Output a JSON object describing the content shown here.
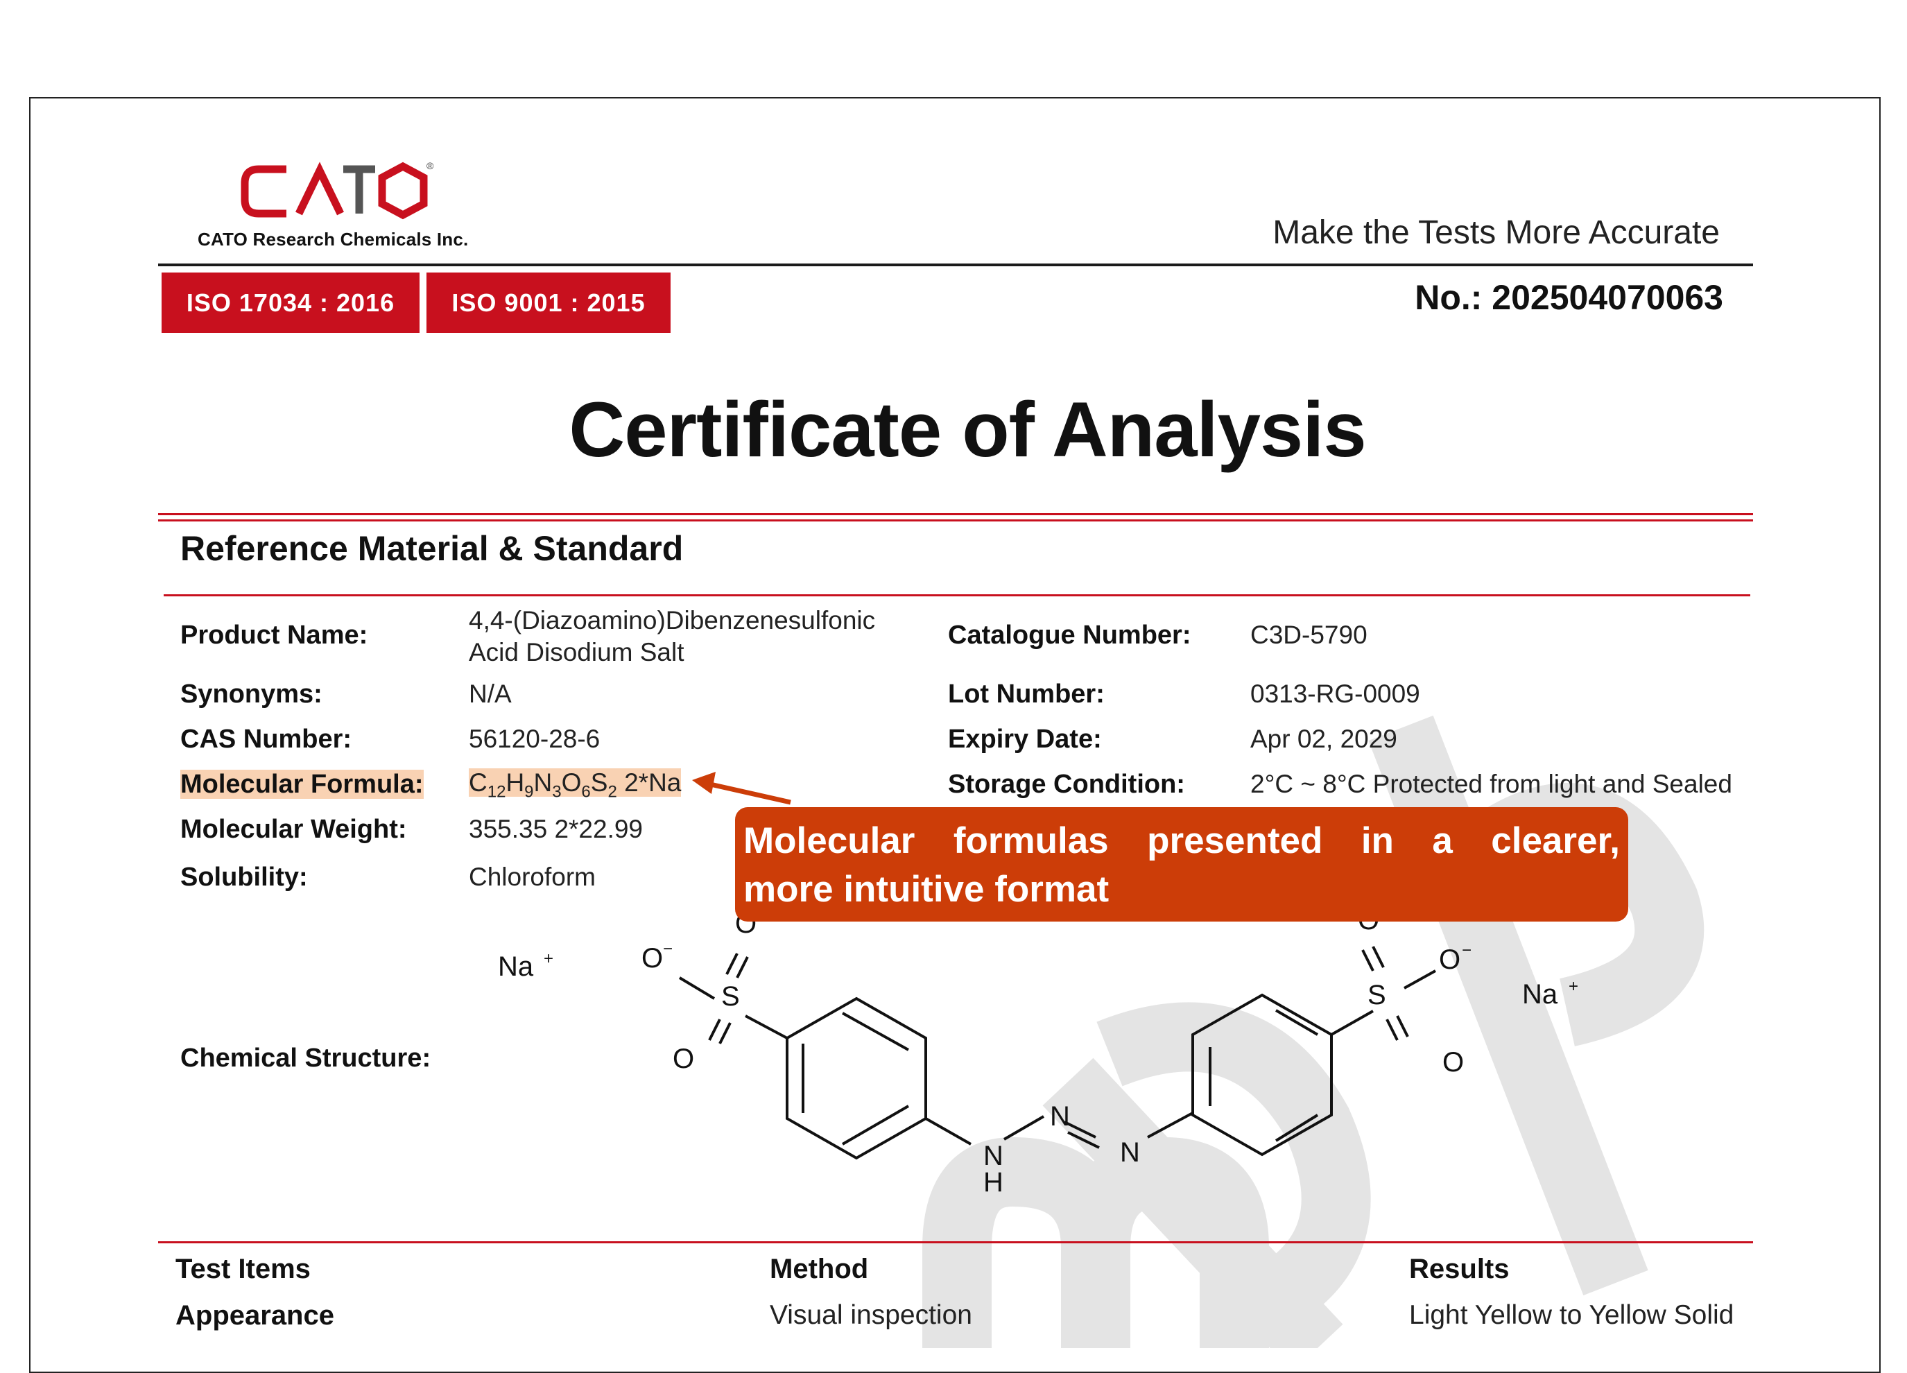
{
  "header": {
    "logo_text": "CATO",
    "company": "CATO Research Chemicals Inc.",
    "slogan": "Make the Tests More Accurate",
    "iso": [
      "ISO 17034 : 2016",
      "ISO 9001 : 2015"
    ],
    "doc_no": "No.: 202504070063"
  },
  "title": "Certificate of Analysis",
  "section_title": "Reference Material & Standard",
  "fields": {
    "product_name_label": "Product Name:",
    "product_name_line1": "4,4-(Diazoamino)Dibenzenesulfonic",
    "product_name_line2": "Acid Disodium Salt",
    "synonyms_label": "Synonyms:",
    "synonyms": "N/A",
    "cas_label": "CAS Number:",
    "cas": "56120-28-6",
    "formula_label": "Molecular Formula:",
    "formula_suffix": "2*Na",
    "mw_label": "Molecular Weight:",
    "mw": "355.35 2*22.99",
    "solubility_label": "Solubility:",
    "solubility": "Chloroform",
    "catalogue_label": "Catalogue Number:",
    "catalogue": "C3D-5790",
    "lot_label": "Lot Number:",
    "lot": "0313-RG-0009",
    "expiry_label": "Expiry Date:",
    "expiry": "Apr 02, 2029",
    "storage_label": "Storage Condition:",
    "storage": "2°C ~ 8°C Protected from light and Sealed",
    "structure_label": "Chemical Structure:"
  },
  "structure_atoms": {
    "na": "Na",
    "plus": "+",
    "o": "O",
    "minus": "−",
    "s": "S",
    "n": "N",
    "h": "H"
  },
  "callout": {
    "line1_words": [
      "Molecular",
      "formulas",
      "presented",
      "in",
      "a",
      "clearer,"
    ],
    "line2": "more intuitive format"
  },
  "table": {
    "headers": [
      "Test Items",
      "Method",
      "Results"
    ],
    "row1": [
      "Appearance",
      "Visual inspection",
      "Light Yellow to Yellow Solid"
    ]
  },
  "colors": {
    "brand_red": "#c8101e",
    "callout": "#cc3d08",
    "highlight": "#f9d2b3"
  }
}
